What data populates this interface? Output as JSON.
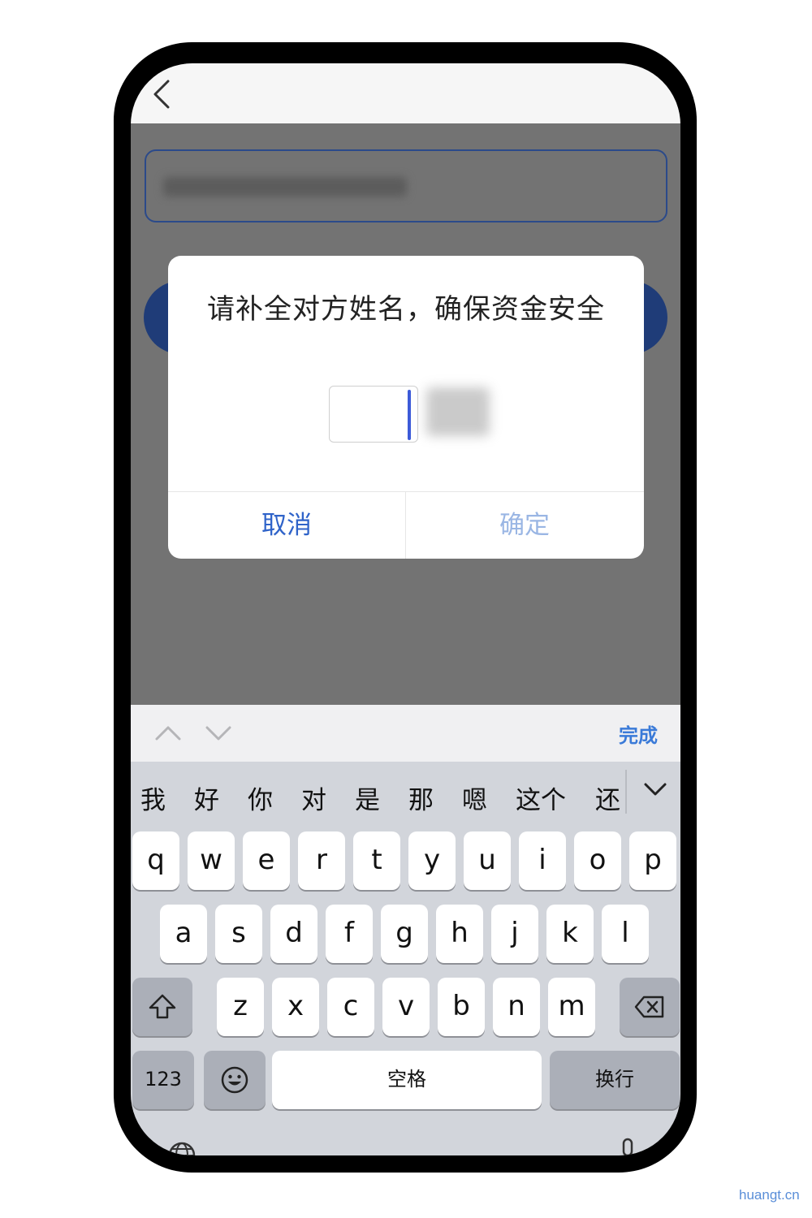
{
  "dialog": {
    "title": "请补全对方姓名，确保资金安全",
    "cancel_label": "取消",
    "confirm_label": "确定",
    "accent_color": "#2f63c9",
    "disabled_color": "#9ab6e4"
  },
  "keyboard_toolbar": {
    "done_label": "完成"
  },
  "keyboard": {
    "candidates": [
      "我",
      "好",
      "你",
      "对",
      "是",
      "那",
      "嗯",
      "这个",
      "还"
    ],
    "row1": [
      "q",
      "w",
      "e",
      "r",
      "t",
      "y",
      "u",
      "i",
      "o",
      "p"
    ],
    "row2": [
      "a",
      "s",
      "d",
      "f",
      "g",
      "h",
      "j",
      "k",
      "l"
    ],
    "row3": [
      "z",
      "x",
      "c",
      "v",
      "b",
      "n",
      "m"
    ],
    "numbers_label": "123",
    "space_label": "空格",
    "return_label": "换行"
  },
  "icons": {
    "back": "chevron-left-icon",
    "prev_field": "chevron-up-icon",
    "next_field": "chevron-down-icon",
    "expand_candidates": "chevron-down-icon",
    "shift": "shift-arrow-icon",
    "delete": "backspace-icon",
    "emoji": "emoji-icon",
    "globe": "globe-icon",
    "mic": "microphone-icon"
  },
  "watermark": "huangt.cn"
}
